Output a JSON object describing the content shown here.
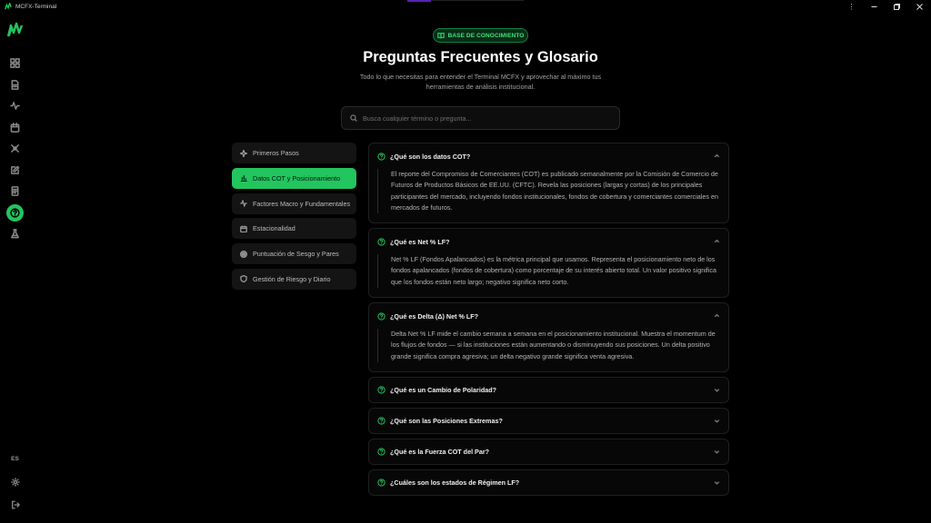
{
  "window": {
    "title": "MCFX-Terminal",
    "controls": [
      "more-icon",
      "minimize-icon",
      "maximize-icon",
      "close-icon"
    ]
  },
  "sidebar": {
    "nav": [
      "dashboard-icon",
      "document-icon",
      "activity-icon",
      "calendar-icon",
      "crosshair-icon",
      "edit-icon",
      "notes-icon",
      "help-icon",
      "flask-icon"
    ],
    "active": "help-icon",
    "language": "ES",
    "bottom": [
      "settings-icon",
      "logout-icon"
    ]
  },
  "header": {
    "badge": "BASE DE CONOCIMIENTO",
    "title": "Preguntas Frecuentes y Glosario",
    "subtitle": "Todo lo que necesitas para entender el Terminal MCFX y aprovechar al máximo tus herramientas de análisis institucional."
  },
  "search": {
    "placeholder": "Busca cualquier término o pregunta...",
    "value": ""
  },
  "categories": [
    {
      "label": "Primeros Pasos",
      "icon": "sparkle-icon",
      "active": false
    },
    {
      "label": "Datos COT y Posicionamiento",
      "icon": "bar-chart-icon",
      "active": true
    },
    {
      "label": "Factores Macro y Fundamentales",
      "icon": "activity-icon",
      "active": false
    },
    {
      "label": "Estacionalidad",
      "icon": "calendar-icon",
      "active": false
    },
    {
      "label": "Puntuación de Sesgo y Pares",
      "icon": "target-icon",
      "active": false
    },
    {
      "label": "Gestión de Riesgo y Diario",
      "icon": "shield-icon",
      "active": false
    }
  ],
  "faq": [
    {
      "question": "¿Qué son los datos COT?",
      "expanded": true,
      "answer": "El reporte del Compromiso de Comerciantes (COT) es publicado semanalmente por la Comisión de Comercio de Futuros de Productos Básicos de EE.UU. (CFTC). Revela las posiciones (largas y cortas) de los principales participantes del mercado, incluyendo fondos institucionales, fondos de cobertura y comerciantes comerciales en mercados de futuros."
    },
    {
      "question": "¿Qué es Net % LF?",
      "expanded": true,
      "answer": "Net % LF (Fondos Apalancados) es la métrica principal que usamos. Representa el posicionamiento neto de los fondos apalancados (fondos de cobertura) como porcentaje de su interés abierto total. Un valor positivo significa que los fondos están neto largo; negativo significa neto corto."
    },
    {
      "question": "¿Qué es Delta (Δ) Net % LF?",
      "expanded": true,
      "answer": "Delta Net % LF mide el cambio semana a semana en el posicionamiento institucional. Muestra el momentum de los flujos de fondos — si las instituciones están aumentando o disminuyendo sus posiciones. Un delta positivo grande significa compra agresiva; un delta negativo grande significa venta agresiva."
    },
    {
      "question": "¿Qué es un Cambio de Polaridad?",
      "expanded": false,
      "answer": ""
    },
    {
      "question": "¿Qué son las Posiciones Extremas?",
      "expanded": false,
      "answer": ""
    },
    {
      "question": "¿Qué es la Fuerza COT del Par?",
      "expanded": false,
      "answer": ""
    },
    {
      "question": "¿Cuáles son los estados de Régimen LF?",
      "expanded": false,
      "answer": ""
    }
  ],
  "colors": {
    "accent": "#22c55e",
    "background": "#000000",
    "card": "#070707"
  }
}
